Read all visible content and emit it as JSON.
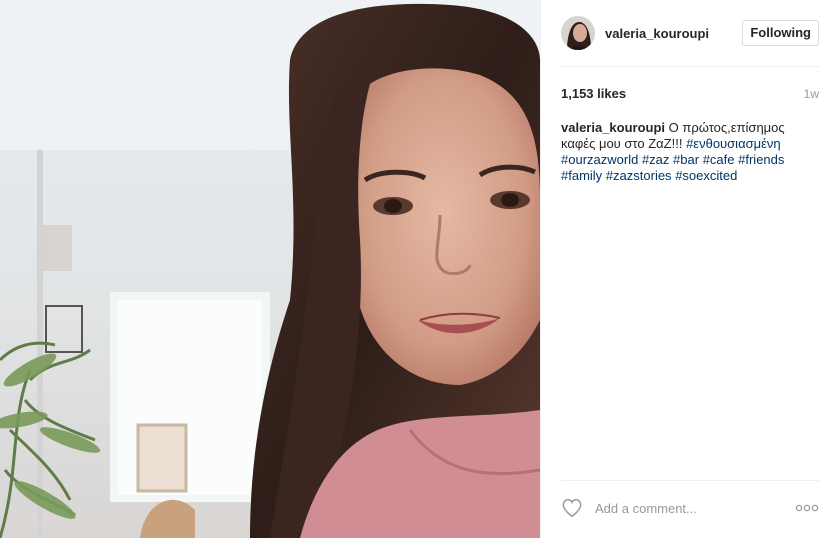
{
  "post": {
    "username": "valeria_kouroupi",
    "follow_label": "Following",
    "likes": "1,153 likes",
    "time": "1w",
    "caption": {
      "username": "valeria_kouroupi",
      "text": " Ο πρώτος,επίσημος καφές μου στο ΖαΖ!!! ",
      "tags": [
        "#ενθουσιασμένη",
        "#ourzazworld",
        "#zaz",
        "#bar",
        "#cafe",
        "#friends",
        "#family",
        "#zazstories",
        "#soexcited"
      ]
    }
  },
  "comment": {
    "placeholder": "Add a comment..."
  },
  "icons": {
    "like": "heart-outline-icon",
    "more": "more-options-icon"
  },
  "colors": {
    "hashtag": "#003569",
    "meta_gray": "#999999",
    "border": "#efefef"
  }
}
